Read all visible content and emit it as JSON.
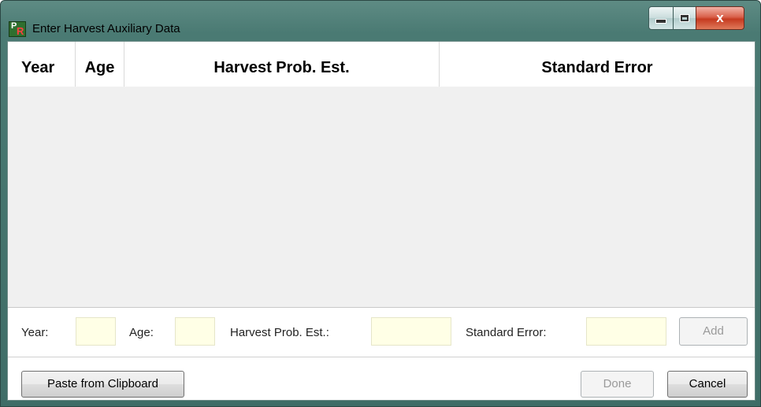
{
  "window": {
    "title": "Enter Harvest Auxiliary Data",
    "icon": "app-pr-icon",
    "controls": {
      "minimize": "minimize-icon",
      "maximize": "maximize-icon",
      "close": "x"
    }
  },
  "grid": {
    "columns": [
      "Year",
      "Age",
      "Harvest Prob. Est.",
      "Standard Error"
    ],
    "rows": []
  },
  "entry": {
    "year_label": "Year:",
    "age_label": "Age:",
    "hpe_label": "Harvest Prob. Est.:",
    "se_label": "Standard Error:",
    "year_value": "",
    "age_value": "",
    "hpe_value": "",
    "se_value": "",
    "add_label": "Add"
  },
  "actions": {
    "paste_label": "Paste from Clipboard",
    "done_label": "Done",
    "cancel_label": "Cancel"
  },
  "colors": {
    "field_bg": "#ffffe6",
    "title_bar": "#4a7a73",
    "close_button": "#c53a20"
  }
}
